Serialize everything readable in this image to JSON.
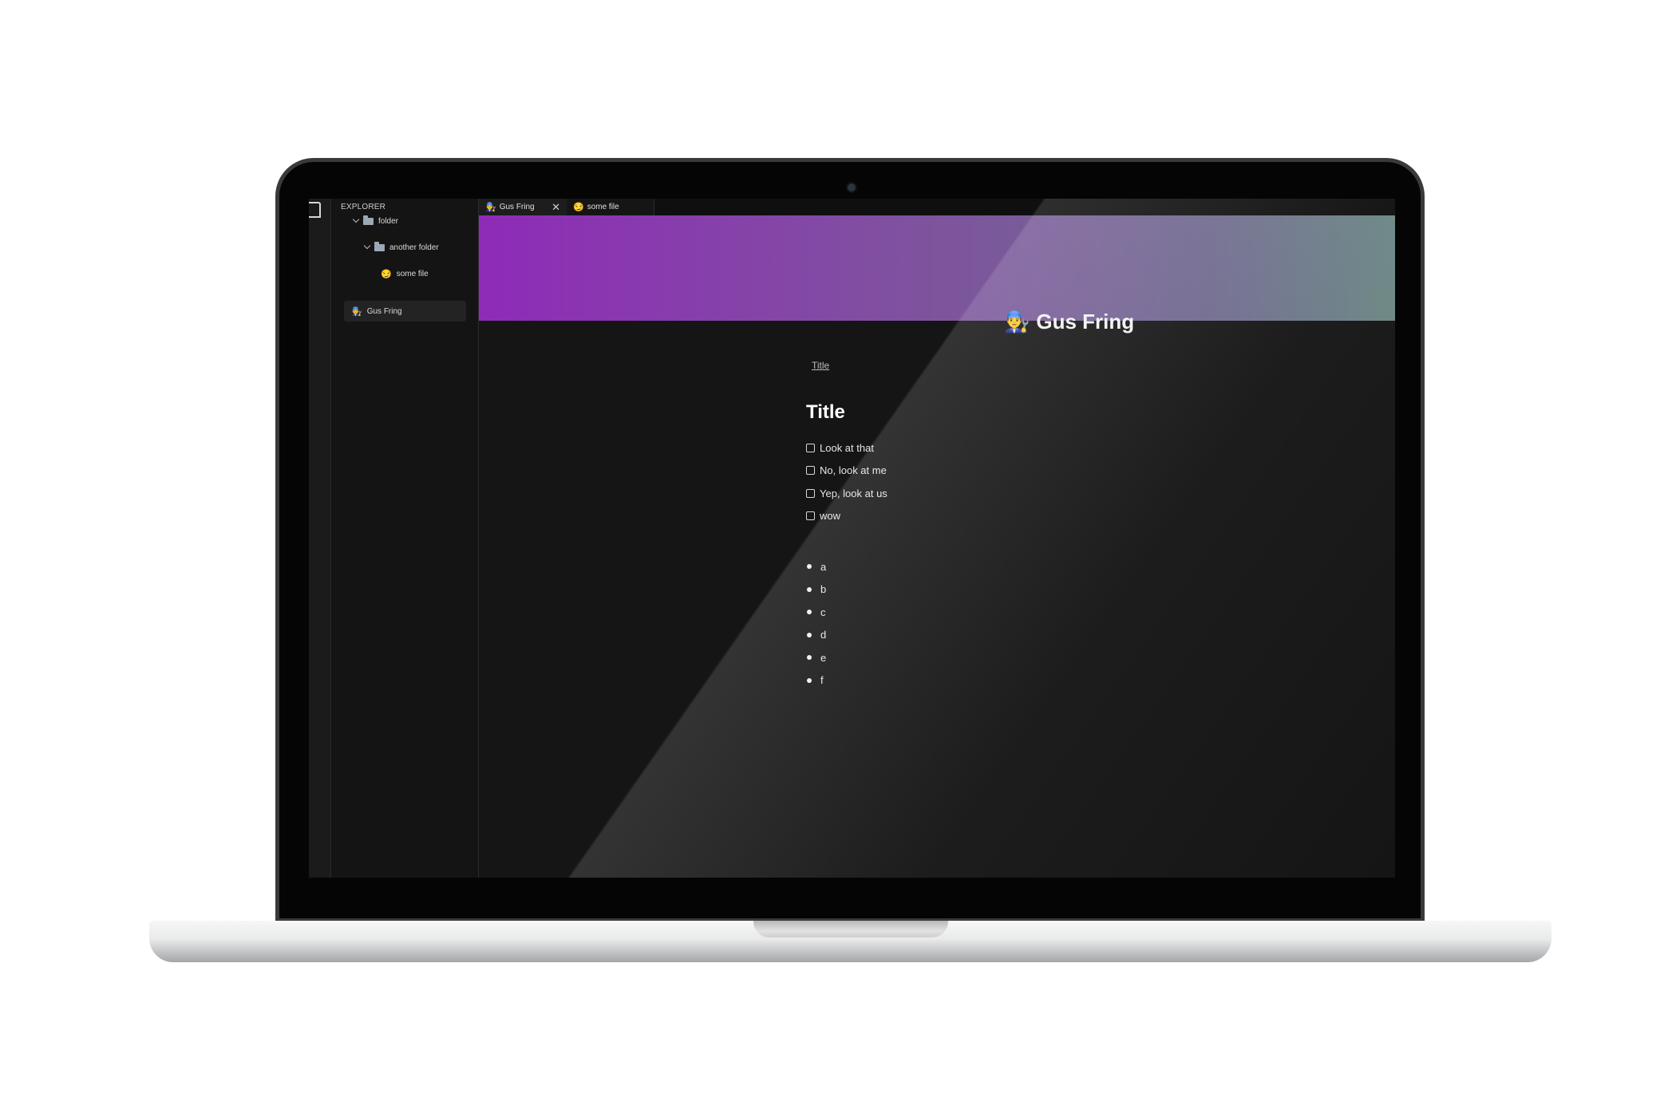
{
  "sidebar": {
    "title": "EXPLORER",
    "tree": [
      {
        "label": "folder",
        "type": "folder"
      },
      {
        "label": "another folder",
        "type": "folder"
      },
      {
        "label": "some file",
        "icon": "😏"
      },
      {
        "label": "Gus Fring",
        "icon": "👨‍🔧",
        "selected": true
      }
    ]
  },
  "tabs": [
    {
      "label": "Gus Fring",
      "icon": "👨‍🔧",
      "active": true
    },
    {
      "label": "some file",
      "icon": "😏",
      "active": false
    }
  ],
  "page": {
    "title": "Gus Fring",
    "icon": "👨‍🔧",
    "breadcrumb": "Title",
    "heading": "Title",
    "todos": [
      "Look at that",
      "No, look at me",
      "Yep, look at us",
      "wow"
    ],
    "bullets": [
      "a",
      "b",
      "c",
      "d",
      "e",
      "f"
    ]
  },
  "colors": {
    "banner_start": "#8e2bb8",
    "banner_end": "#6b8784",
    "editor_bg": "#151515"
  }
}
